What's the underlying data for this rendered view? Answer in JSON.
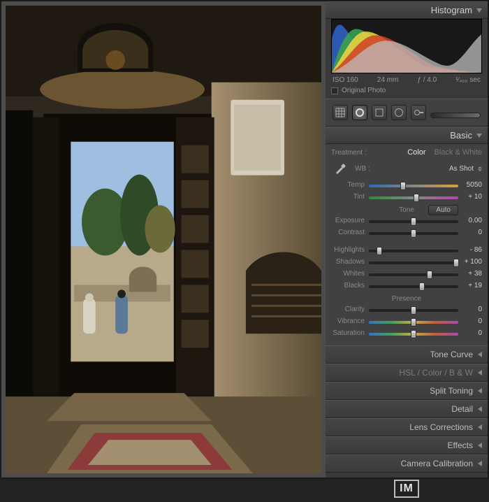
{
  "histogram": {
    "title": "Histogram",
    "meta": {
      "iso": "ISO 160",
      "focal": "24 mm",
      "aperture": "ƒ / 4.0",
      "shutter": "¹⁄₄₀₀ sec"
    },
    "original_label": "Original Photo"
  },
  "basic": {
    "title": "Basic",
    "treatment_label": "Treatment :",
    "treat_color": "Color",
    "treat_bw": "Black & White",
    "wb_label": "WB :",
    "wb_value": "As Shot",
    "tone_label": "Tone",
    "auto_label": "Auto",
    "presence_label": "Presence",
    "sliders": {
      "temp": {
        "label": "Temp",
        "value": "5050",
        "pos": 38
      },
      "tint": {
        "label": "Tint",
        "value": "+ 10",
        "pos": 53
      },
      "exposure": {
        "label": "Exposure",
        "value": "0.00",
        "pos": 50
      },
      "contrast": {
        "label": "Contrast",
        "value": "0",
        "pos": 50
      },
      "highlights": {
        "label": "Highlights",
        "value": "- 86",
        "pos": 12
      },
      "shadows": {
        "label": "Shadows",
        "value": "+ 100",
        "pos": 98
      },
      "whites": {
        "label": "Whites",
        "value": "+ 38",
        "pos": 68
      },
      "blacks": {
        "label": "Blacks",
        "value": "+ 19",
        "pos": 59
      },
      "clarity": {
        "label": "Clarity",
        "value": "0",
        "pos": 50
      },
      "vibrance": {
        "label": "Vibrance",
        "value": "0",
        "pos": 50
      },
      "saturation": {
        "label": "Saturation",
        "value": "0",
        "pos": 50
      }
    }
  },
  "panels": {
    "tonecurve": "Tone Curve",
    "hsl": "HSL / Color / B & W",
    "split": "Split Toning",
    "detail": "Detail",
    "lens": "Lens Corrections",
    "effects": "Effects",
    "calib": "Camera Calibration"
  },
  "logo": "IM"
}
